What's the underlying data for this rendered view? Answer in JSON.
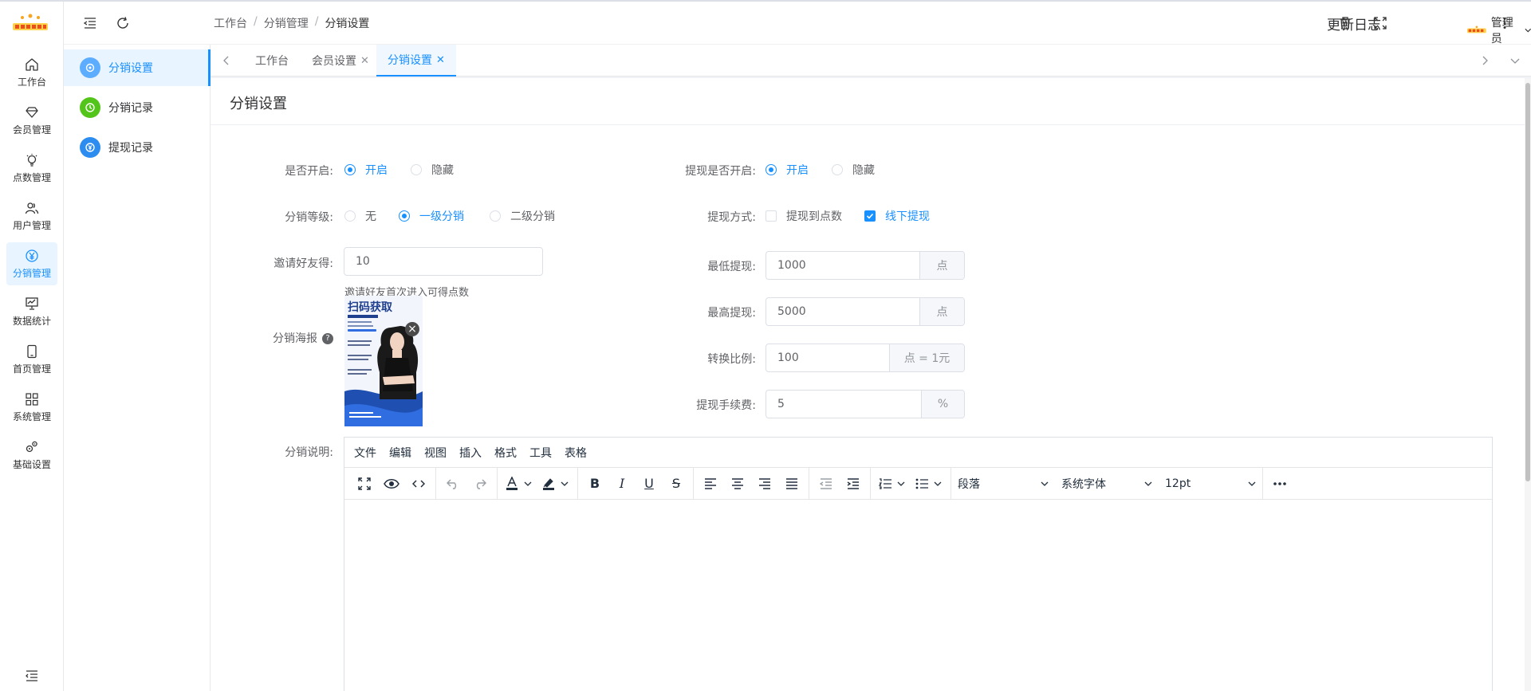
{
  "header": {
    "breadcrumb": [
      "工作台",
      "分销管理",
      "分销设置"
    ],
    "changelog": "更新日志",
    "admin_name": "管理员"
  },
  "rail": {
    "items": [
      {
        "label": "工作台",
        "icon": "home-icon",
        "active": false
      },
      {
        "label": "会员管理",
        "icon": "diamond-icon",
        "active": false
      },
      {
        "label": "点数管理",
        "icon": "bulb-icon",
        "active": false
      },
      {
        "label": "用户管理",
        "icon": "users-icon",
        "active": false
      },
      {
        "label": "分销管理",
        "icon": "yen-icon",
        "active": true
      },
      {
        "label": "数据统计",
        "icon": "chart-board-icon",
        "active": false
      },
      {
        "label": "首页管理",
        "icon": "tablet-icon",
        "active": false
      },
      {
        "label": "系统管理",
        "icon": "grid-icon",
        "active": false
      },
      {
        "label": "基础设置",
        "icon": "gears-icon",
        "active": false
      }
    ]
  },
  "submenu": {
    "items": [
      {
        "label": "分销设置",
        "color": "#5cadff",
        "icon": "settings-icon",
        "active": true
      },
      {
        "label": "分销记录",
        "color": "#52c41a",
        "icon": "clock-icon",
        "active": false
      },
      {
        "label": "提现记录",
        "color": "#2d8cf0",
        "icon": "yen-circle-icon",
        "active": false
      }
    ]
  },
  "tabs": [
    {
      "label": "工作台",
      "closable": false
    },
    {
      "label": "会员设置",
      "closable": true
    },
    {
      "label": "分销设置",
      "closable": true,
      "active": true
    }
  ],
  "page": {
    "title": "分销设置"
  },
  "form": {
    "enable": {
      "label": "是否开启:",
      "options": [
        "开启",
        "隐藏"
      ],
      "selected": "开启"
    },
    "level": {
      "label": "分销等级:",
      "options": [
        "无",
        "一级分销",
        "二级分销"
      ],
      "selected": "一级分销"
    },
    "invite": {
      "label": "邀请好友得:",
      "value": "10",
      "hint": "邀请好友首次进入可得点数"
    },
    "poster": {
      "label": "分销海报",
      "help": "?",
      "headline": "扫码获取"
    },
    "withdraw_enable": {
      "label": "提现是否开启:",
      "options": [
        "开启",
        "隐藏"
      ],
      "selected": "开启"
    },
    "withdraw_method": {
      "label": "提现方式:",
      "options": [
        {
          "text": "提现到点数",
          "checked": false
        },
        {
          "text": "线下提现",
          "checked": true
        }
      ]
    },
    "min_withdraw": {
      "label": "最低提现:",
      "value": "1000",
      "unit": "点"
    },
    "max_withdraw": {
      "label": "最高提现:",
      "value": "5000",
      "unit": "点"
    },
    "ratio": {
      "label": "转换比例:",
      "value": "100",
      "unit": "点 = 1元"
    },
    "fee": {
      "label": "提现手续费:",
      "value": "5",
      "unit": "%"
    },
    "desc": {
      "label": "分销说明:"
    }
  },
  "editor": {
    "menus": [
      "文件",
      "编辑",
      "视图",
      "插入",
      "格式",
      "工具",
      "表格"
    ],
    "paragraph": "段落",
    "font": "系统字体",
    "size": "12pt"
  },
  "colors": {
    "accent": "#1890ff",
    "rail_active_bg": "#e8f4ff"
  }
}
